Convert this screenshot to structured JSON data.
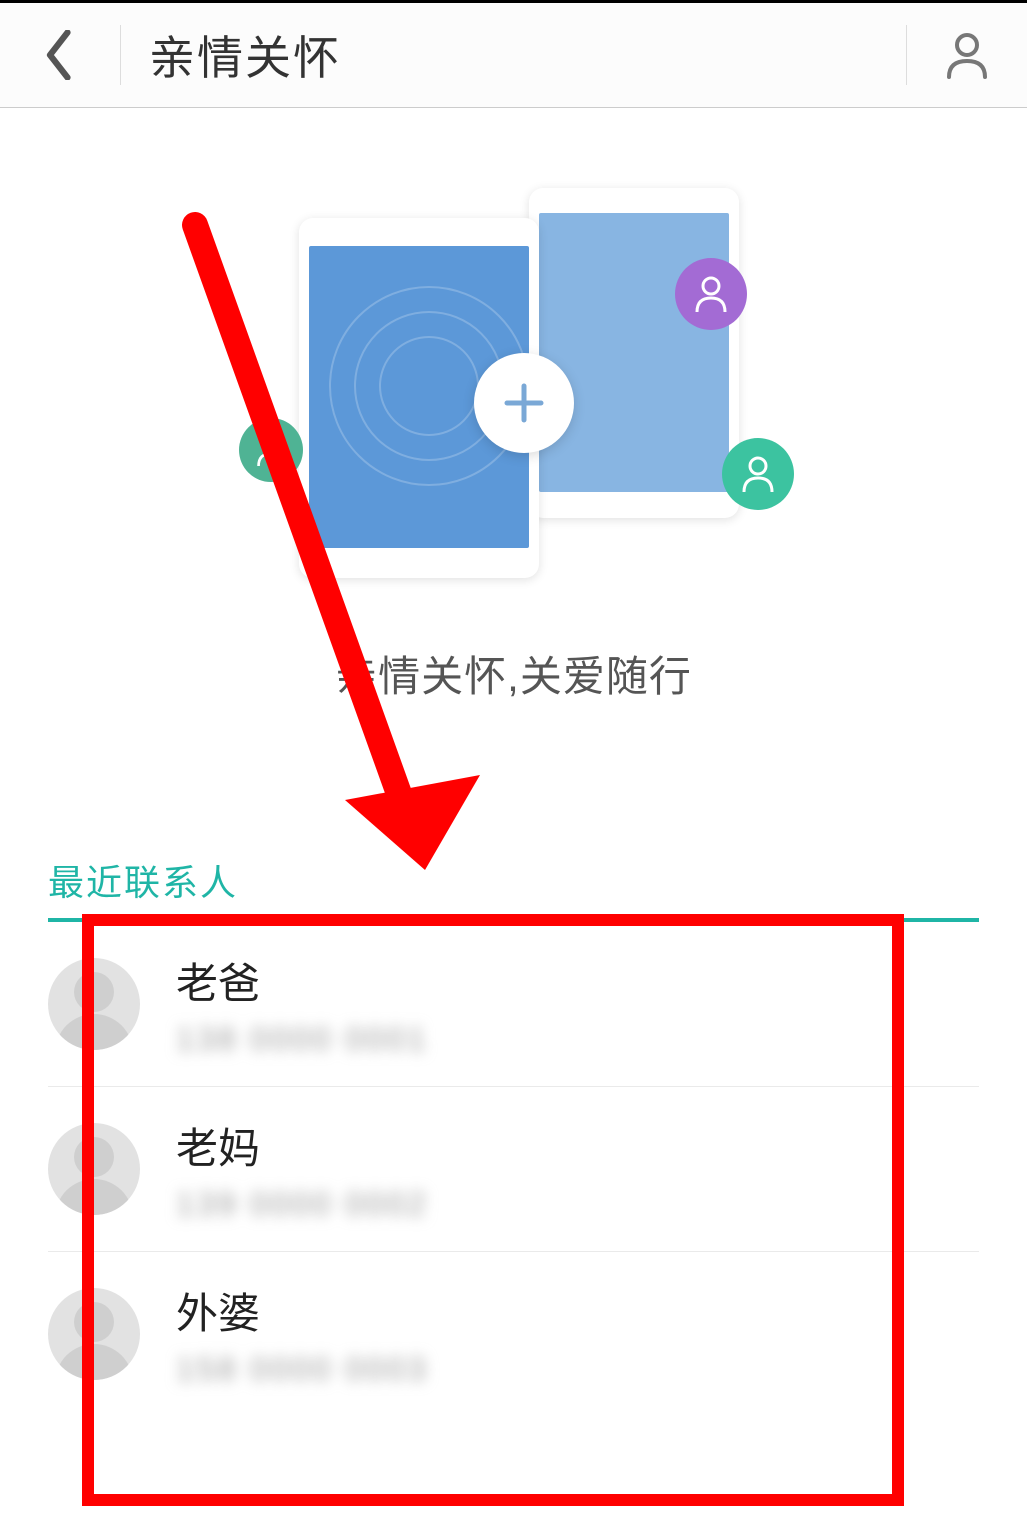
{
  "header": {
    "title": "亲情关怀"
  },
  "hero": {
    "tagline": "亲情关怀,关爱随行",
    "plus_label": "+"
  },
  "section": {
    "title": "最近联系人"
  },
  "contacts": [
    {
      "name": "老爸",
      "phone_masked": "138 0000 0001"
    },
    {
      "name": "老妈",
      "phone_masked": "139 0000 0002"
    },
    {
      "name": "外婆",
      "phone_masked": "158 0000 0003"
    }
  ],
  "colors": {
    "accent": "#1fb5a6",
    "annotation": "#ff0000"
  }
}
